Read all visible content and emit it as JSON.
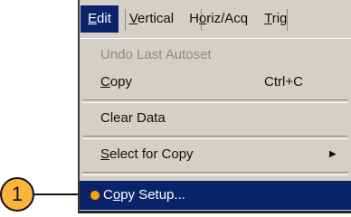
{
  "menubar": {
    "items": [
      {
        "label": "Edit",
        "mnemonic": "E",
        "rest": "dit",
        "active": true
      },
      {
        "label": "Vertical",
        "mnemonic": "V",
        "rest": "ertical"
      },
      {
        "label": "Horiz/Acq",
        "pre": "H",
        "mnemonic": "o",
        "rest": "riz/Acq"
      },
      {
        "label": "Trig",
        "mnemonic": "T",
        "rest": "rig"
      }
    ]
  },
  "menu": {
    "undo": "Undo Last Autoset",
    "copy": {
      "mnemonic": "C",
      "rest": "opy",
      "shortcut": "Ctrl+C"
    },
    "clear_data": "Clear Data",
    "select_for_copy": {
      "mnemonic": "S",
      "rest": "elect for Copy",
      "submenu_icon": "triangle-right"
    },
    "copy_setup": {
      "pre": "C",
      "mnemonic": "o",
      "rest": "py Setup..."
    }
  },
  "callout": {
    "number": "1"
  },
  "colors": {
    "menu_bg": "#d4d0c8",
    "highlight": "#0a246a",
    "callout": "#fbb53c",
    "bullet": "#f7a800",
    "disabled_text": "#8c8a84"
  }
}
